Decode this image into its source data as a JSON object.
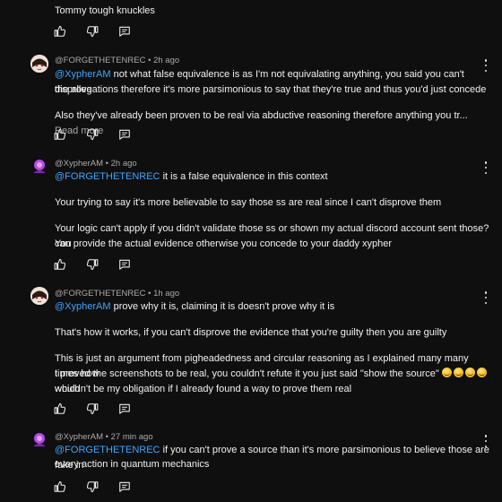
{
  "top_comment": {
    "text": "Tommy tough knuckles"
  },
  "comments": [
    {
      "author": "@FORGETHETENREC",
      "time": "2h ago",
      "mention": "@XypherAM",
      "line1_rest": " not what false equivalence is as I'm not equivalating anything, you said you can't disprove",
      "line2": "the allegations therefore it's more parsimonious to say that they're true and thus you'd just concede",
      "line3": "Also they've already been proven to be real via abductive reasoning therefore anything you tr...",
      "read_more": "Read more"
    },
    {
      "author": "@XypherAM",
      "time": "2h ago",
      "mention": "@FORGETHETENREC",
      "line1_rest": " it is a false equivalence in this context",
      "line2": "Your trying to say it's more believable to say those ss are real since I can't disprove them",
      "line3": "Your logic can't apply if you didn't validate those ss or shown my actual discord account sent those? You",
      "line4": "can provide the actual evidence otherwise you concede to your daddy xypher"
    },
    {
      "author": "@FORGETHETENREC",
      "time": "1h ago",
      "mention": "@XypherAM",
      "line1_rest": "  prove why it is, claiming it is doesn't prove why it is",
      "line2": "That's how it works, if you can't disprove the evidence that you're guilty then you are guilty",
      "line3": "This is just an argument from pigheadedness and circular reasoning as I explained many many times how",
      "line4a": "I proved the screenshots to be real, you couldn't refute it you just said \"show the source\"",
      "line4b": " which",
      "line5": "wouldn't be my obligation if I already found a way to prove them real"
    },
    {
      "author": "@XypherAM",
      "time": "27 min ago",
      "mention": "@FORGETHETENREC",
      "line1_rest": " if you can't prove a source than it's more parsimonious to believe those are fake in",
      "line2": "every action in quantum mechanics"
    }
  ],
  "separator": " • "
}
